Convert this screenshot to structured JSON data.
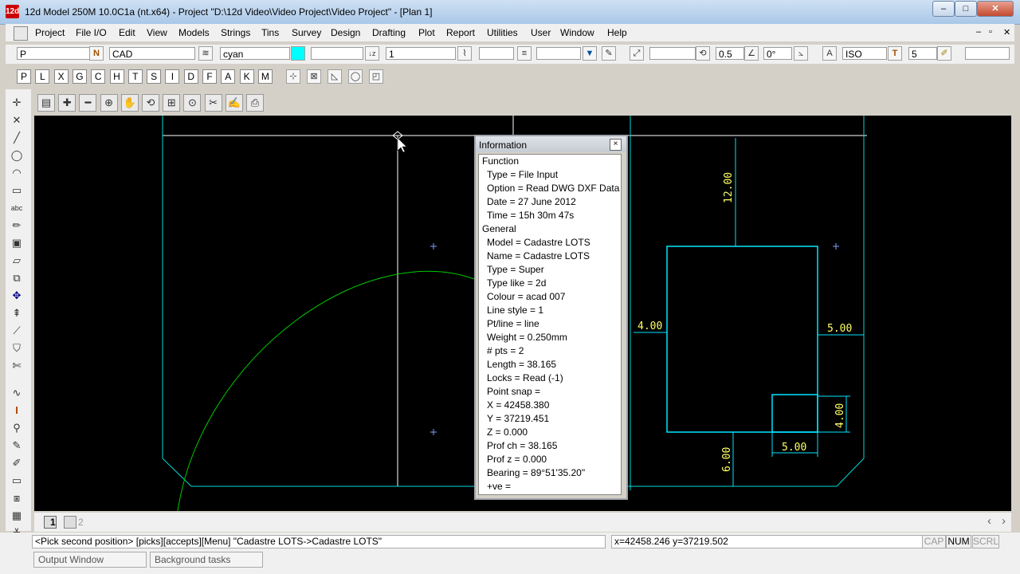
{
  "window": {
    "app_icon": "12d",
    "title": "12d Model 250M 10.0C1a (nt.x64) - Project \"D:\\12d Video\\Video Project\\Video Project\" - [Plan 1]",
    "min_label": "–",
    "max_label": "□",
    "close_label": "✕"
  },
  "menu": {
    "items": [
      "Project",
      "File I/O",
      "Edit",
      "View",
      "Models",
      "Strings",
      "Tins",
      "Survey",
      "Design",
      "Drafting",
      "Plot",
      "Report",
      "Utilities",
      "User",
      "Window",
      "Help"
    ],
    "mdi": [
      "–",
      "▫",
      "✕"
    ]
  },
  "toolbar": {
    "name_field": "P",
    "name_flag": "N",
    "model_field": "CAD",
    "colour_field": "cyan",
    "colour_swatch": "#00ffff",
    "chainage_field": "1",
    "text_size": "0.5",
    "angle": "0°",
    "text_style": "ISO",
    "text_height": "5"
  },
  "letter_buttons": [
    "P",
    "L",
    "X",
    "G",
    "C",
    "H",
    "T",
    "S",
    "I",
    "D",
    "F",
    "A",
    "K",
    "M"
  ],
  "plan_tools": [
    "save",
    "zoom-in",
    "zoom-out",
    "zoom-window",
    "pan",
    "zoom-previous",
    "zoom-extent",
    "zoom-fit",
    "measure",
    "pick",
    "plot"
  ],
  "canvas": {
    "background": "#000000",
    "annotations": {
      "top_dim": "12.00",
      "left_dim": "4.00",
      "right_dim": "5.00",
      "small_vertical": "4.00",
      "small_horizontal": "5.00",
      "bottom_dim": "6.00"
    }
  },
  "info_window": {
    "title": "Information",
    "close_label": "×",
    "rows": [
      "Function",
      "  Type = File Input",
      "  Option = Read DWG DXF Data",
      "  Date = 27 June 2012",
      "  Time = 15h 30m 47s",
      "General",
      "  Model = Cadastre LOTS",
      "  Name = Cadastre LOTS",
      "  Type = Super",
      "  Type like = 2d",
      "  Colour = acad 007",
      "  Line style = 1",
      "  Pt/line = line",
      "  Weight = 0.250mm",
      "  # pts = 2",
      "  Length = 38.165",
      "  Locks = Read (-1)",
      "  Point snap =",
      "  X = 42458.380",
      "  Y = 37219.451",
      "  Z = 0.000",
      "  Prof ch = 38.165",
      "  Prof z = 0.000",
      "  Bearing = 89°51'35.20\"",
      "  +ve ="
    ]
  },
  "view_tabs": [
    "1",
    "2"
  ],
  "scroll_arrows": {
    "left": "‹",
    "right": "›"
  },
  "status": {
    "prompt": "<Pick second position> [picks][accepts][Menu] \"Cadastre LOTS->Cadastre LOTS\"",
    "coords": "x=42458.246 y=37219.502",
    "cap": "CAP",
    "num": "NUM",
    "scrl": "SCRL"
  },
  "bottom_tabs": [
    "Output Window",
    "Background tasks"
  ]
}
